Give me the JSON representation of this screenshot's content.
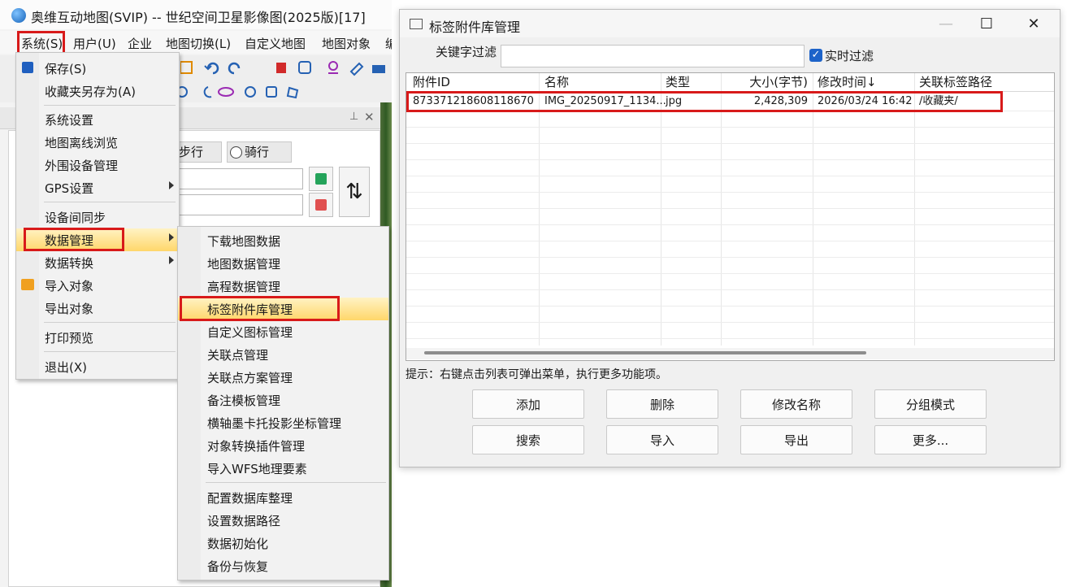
{
  "app": {
    "title": "奥维互动地图(SVIP) -- 世纪空间卫星影像图(2025版)[17]",
    "menubar": [
      "系统(S)",
      "用户(U)",
      "企业",
      "地图切换(L)",
      "自定义地图",
      "地图对象",
      "编"
    ],
    "panel": {
      "mode_walk": "步行",
      "mode_ride": "骑行",
      "swap_glyph": "⇅"
    }
  },
  "system_menu": {
    "items": [
      {
        "label": "保存(S)",
        "icon": "save-icon"
      },
      {
        "label": "收藏夹另存为(A)"
      },
      {
        "label": "系统设置"
      },
      {
        "label": "地图离线浏览"
      },
      {
        "label": "外围设备管理"
      },
      {
        "label": "GPS设置",
        "submenu": true
      },
      {
        "label": "设备间同步"
      },
      {
        "label": "数据管理",
        "submenu": true,
        "highlighted": true
      },
      {
        "label": "数据转换",
        "submenu": true
      },
      {
        "label": "导入对象",
        "icon": "folder-import-icon"
      },
      {
        "label": "导出对象"
      },
      {
        "label": "打印预览"
      },
      {
        "label": "退出(X)"
      }
    ]
  },
  "data_menu": {
    "items": [
      {
        "label": "下载地图数据"
      },
      {
        "label": "地图数据管理"
      },
      {
        "label": "高程数据管理"
      },
      {
        "label": "标签附件库管理",
        "highlighted": true
      },
      {
        "label": "自定义图标管理"
      },
      {
        "label": "关联点管理"
      },
      {
        "label": "关联点方案管理"
      },
      {
        "label": "备注模板管理"
      },
      {
        "label": "横轴墨卡托投影坐标管理"
      },
      {
        "label": "对象转换插件管理"
      },
      {
        "label": "导入WFS地理要素"
      },
      {
        "label": "配置数据库整理"
      },
      {
        "label": "设置数据路径"
      },
      {
        "label": "数据初始化"
      },
      {
        "label": "备份与恢复"
      }
    ]
  },
  "dialog": {
    "title": "标签附件库管理",
    "filter_label": "关键字过滤",
    "filter_value": "",
    "realtime_label": "实时过滤",
    "realtime_checked": true,
    "columns": [
      "附件ID",
      "名称",
      "类型",
      "大小(字节)",
      "修改时间↓",
      "关联标签路径"
    ],
    "rows": [
      [
        "873371218608118670",
        "IMG_20250917_1134...",
        "jpg",
        "2,428,309",
        "2026/03/24 16:42",
        "/收藏夹/"
      ]
    ],
    "hint": "提示：右键点击列表可弹出菜单，执行更多功能项。",
    "buttons_row1": [
      "添加",
      "删除",
      "修改名称",
      "分组模式"
    ],
    "buttons_row2": [
      "搜索",
      "导入",
      "导出",
      "更多..."
    ],
    "window_controls": {
      "minimize": "—",
      "maximize": "☐",
      "close": "✕"
    }
  },
  "colors": {
    "highlight_red": "#d81a1a",
    "menu_highlight": "#ffd76a",
    "checkbox_blue": "#1d63c9"
  }
}
